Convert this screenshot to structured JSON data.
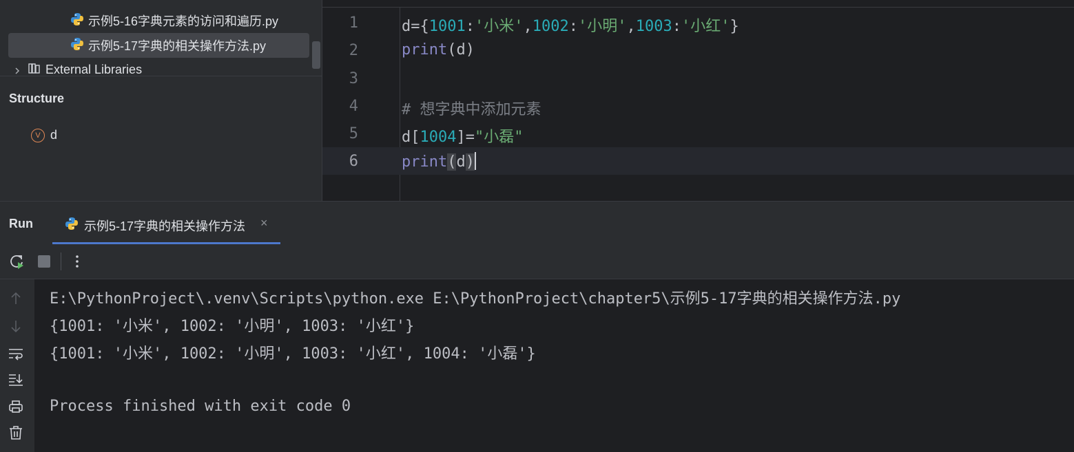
{
  "project_tree": {
    "items": [
      {
        "label": "示例5-16字典元素的访问和遍历.py",
        "selected": false
      },
      {
        "label": "示例5-17字典的相关操作方法.py",
        "selected": true
      },
      {
        "label": "External Libraries"
      }
    ]
  },
  "structure": {
    "title": "Structure",
    "item_badge": "V",
    "item_label": "d"
  },
  "editor": {
    "line_numbers": [
      "1",
      "2",
      "3",
      "4",
      "5",
      "6"
    ],
    "line1": {
      "a": "d={",
      "n1": "1001",
      "c1": ":",
      "s1": "'小米'",
      "cm1": ",",
      "n2": "1002",
      "c2": ":",
      "s2": "'小明'",
      "cm2": ",",
      "n3": "1003",
      "c3": ":",
      "s3": "'小红'",
      "end": "}"
    },
    "line2": {
      "fn": "print",
      "open": "(",
      "arg": "d",
      "close": ")"
    },
    "line4": {
      "comment": "# 想字典中添加元素"
    },
    "line5": {
      "a": "d[",
      "num": "1004",
      "b": "]=",
      "str": "\"小磊\""
    },
    "line6": {
      "fn": "print",
      "open": "(",
      "arg": "d",
      "close": ")"
    }
  },
  "run_panel": {
    "title": "Run",
    "tab_label": "示例5-17字典的相关操作方法",
    "close_glyph": "×"
  },
  "console": {
    "lines": [
      "E:\\PythonProject\\.venv\\Scripts\\python.exe E:\\PythonProject\\chapter5\\示例5-17字典的相关操作方法.py",
      "{1001: '小米', 1002: '小明', 1003: '小红'}",
      "{1001: '小米', 1002: '小明', 1003: '小红', 1004: '小磊'}",
      "",
      "Process finished with exit code 0"
    ]
  },
  "icons": {
    "python_file": "python-file-icon",
    "rerun": "rerun-icon",
    "stop": "stop-icon",
    "more": "more-vertical-icon",
    "up": "arrow-up-icon",
    "down": "arrow-down-icon",
    "soft_wrap": "soft-wrap-icon",
    "scroll_to_end": "scroll-to-end-icon",
    "print": "print-icon",
    "trash": "trash-icon"
  }
}
